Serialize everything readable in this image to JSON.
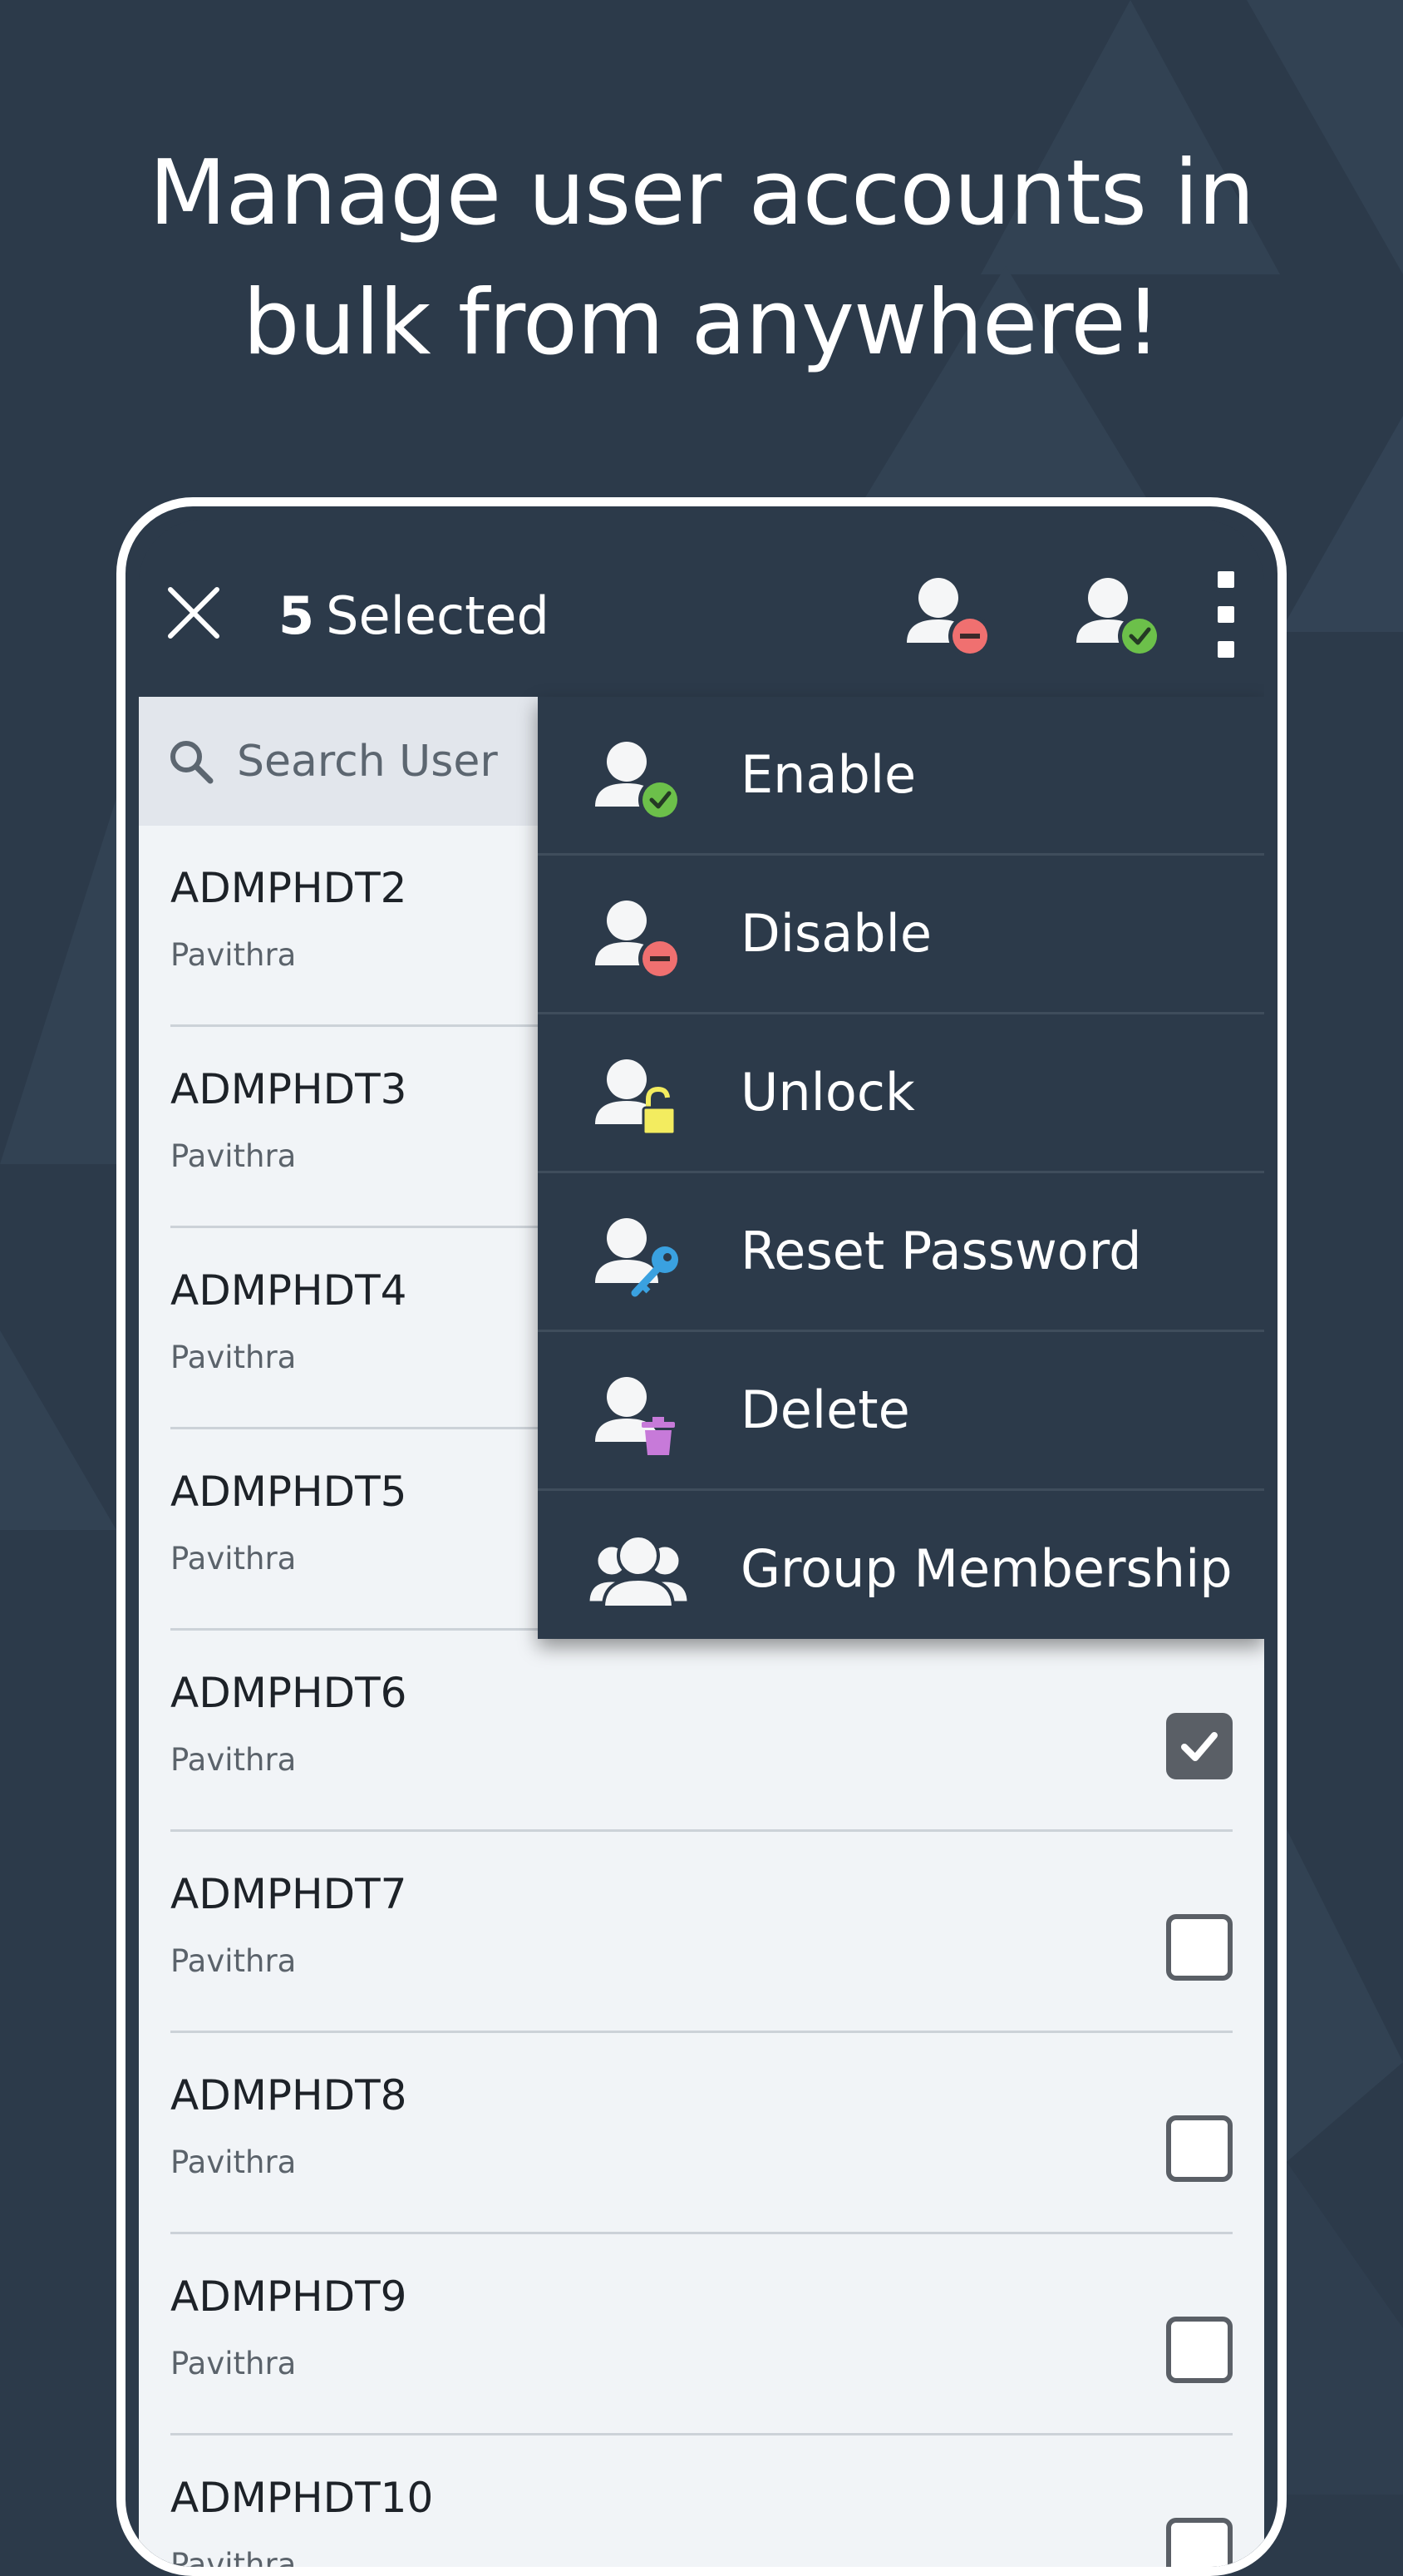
{
  "headline": {
    "line1": "Manage user accounts in",
    "line2": "bulk from anywhere!"
  },
  "appbar": {
    "selected_count": "5",
    "selected_label": "Selected"
  },
  "search": {
    "placeholder": "Search User"
  },
  "menu": [
    {
      "label": "Enable",
      "icon": "user-enable-icon"
    },
    {
      "label": "Disable",
      "icon": "user-disable-icon"
    },
    {
      "label": "Unlock",
      "icon": "user-unlock-icon"
    },
    {
      "label": "Reset Password",
      "icon": "user-reset-password-icon"
    },
    {
      "label": "Delete",
      "icon": "user-delete-icon"
    },
    {
      "label": "Group Membership",
      "icon": "group-membership-icon"
    }
  ],
  "users": [
    {
      "name": "ADMPHDT2",
      "sub": "Pavithra",
      "checked": true
    },
    {
      "name": "ADMPHDT3",
      "sub": "Pavithra",
      "checked": true
    },
    {
      "name": "ADMPHDT4",
      "sub": "Pavithra",
      "checked": true
    },
    {
      "name": "ADMPHDT5",
      "sub": "Pavithra",
      "checked": true
    },
    {
      "name": "ADMPHDT6",
      "sub": "Pavithra",
      "checked": true
    },
    {
      "name": "ADMPHDT7",
      "sub": "Pavithra",
      "checked": false
    },
    {
      "name": "ADMPHDT8",
      "sub": "Pavithra",
      "checked": false
    },
    {
      "name": "ADMPHDT9",
      "sub": "Pavithra",
      "checked": false
    },
    {
      "name": "ADMPHDT10",
      "sub": "Pavithra",
      "checked": false
    }
  ],
  "colors": {
    "background": "#2c3a4a",
    "list_background": "#f1f4f7",
    "enable_green": "#6cc04a",
    "disable_red": "#f07070",
    "unlock_yellow": "#f3ec5f",
    "reset_blue": "#3aa1e0",
    "delete_purple": "#c77ad9"
  }
}
